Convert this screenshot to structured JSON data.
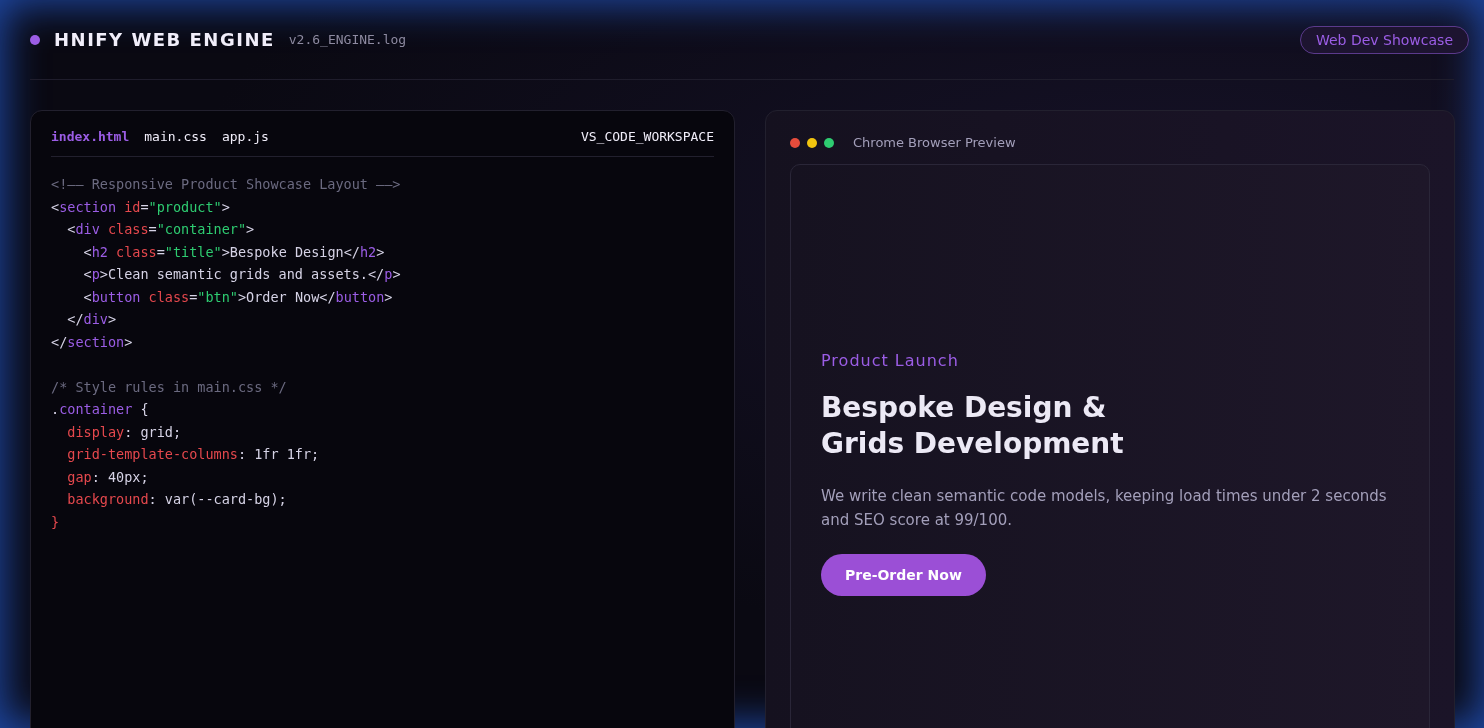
{
  "header": {
    "brand": "HNIFY WEB ENGINE",
    "version": "v2.6_ENGINE.log",
    "badge": "Web Dev Showcase"
  },
  "editor": {
    "tabs": [
      {
        "label": "index.html",
        "selected": true
      },
      {
        "label": "main.css",
        "selected": false
      },
      {
        "label": "app.js",
        "selected": false
      }
    ],
    "workspace": "VS_CODE_WORKSPACE",
    "lines": [
      {
        "kind": "code",
        "tokens": [
          {
            "kind": "comment",
            "text": "<!—— Responsive Product Showcase Layout ——>"
          }
        ]
      },
      {
        "kind": "code",
        "tokens": [
          {
            "kind": "punct",
            "text": "<"
          },
          {
            "kind": "tag",
            "text": "section"
          },
          {
            "kind": "attr",
            "text": " id"
          },
          {
            "kind": "punct",
            "text": "="
          },
          {
            "kind": "string",
            "text": "\"product\""
          },
          {
            "kind": "punct",
            "text": ">"
          }
        ]
      },
      {
        "kind": "code",
        "tokens": [
          {
            "kind": "punct",
            "text": "  <"
          },
          {
            "kind": "tag",
            "text": "div"
          },
          {
            "kind": "attr",
            "text": " class"
          },
          {
            "kind": "punct",
            "text": "="
          },
          {
            "kind": "string",
            "text": "\"container\""
          },
          {
            "kind": "punct",
            "text": ">"
          }
        ]
      },
      {
        "kind": "code",
        "tokens": [
          {
            "kind": "punct",
            "text": "    <"
          },
          {
            "kind": "tag",
            "text": "h2"
          },
          {
            "kind": "attr",
            "text": " class"
          },
          {
            "kind": "punct",
            "text": "="
          },
          {
            "kind": "string",
            "text": "\"title\""
          },
          {
            "kind": "punct",
            "text": ">Bespoke Design</"
          },
          {
            "kind": "tag",
            "text": "h2"
          },
          {
            "kind": "punct",
            "text": ">"
          }
        ]
      },
      {
        "kind": "code",
        "tokens": [
          {
            "kind": "punct",
            "text": "    <"
          },
          {
            "kind": "tag",
            "text": "p"
          },
          {
            "kind": "punct",
            "text": ">Clean semantic grids and assets.</"
          },
          {
            "kind": "tag",
            "text": "p"
          },
          {
            "kind": "punct",
            "text": ">"
          }
        ]
      },
      {
        "kind": "code",
        "tokens": [
          {
            "kind": "punct",
            "text": "    <"
          },
          {
            "kind": "tag",
            "text": "button"
          },
          {
            "kind": "attr",
            "text": " class"
          },
          {
            "kind": "punct",
            "text": "="
          },
          {
            "kind": "string",
            "text": "\"btn\""
          },
          {
            "kind": "punct",
            "text": ">Order Now</"
          },
          {
            "kind": "tag",
            "text": "button"
          },
          {
            "kind": "punct",
            "text": ">"
          }
        ]
      },
      {
        "kind": "code",
        "tokens": [
          {
            "kind": "punct",
            "text": "  </"
          },
          {
            "kind": "tag",
            "text": "div"
          },
          {
            "kind": "punct",
            "text": ">"
          }
        ]
      },
      {
        "kind": "code",
        "tokens": [
          {
            "kind": "punct",
            "text": "</"
          },
          {
            "kind": "tag",
            "text": "section"
          },
          {
            "kind": "punct",
            "text": ">"
          }
        ]
      },
      {
        "kind": "blank"
      },
      {
        "kind": "code",
        "tokens": [
          {
            "kind": "comment",
            "text": "/* Style rules in main.css */"
          }
        ]
      },
      {
        "kind": "code",
        "tokens": [
          {
            "kind": "punct",
            "text": "."
          },
          {
            "kind": "tag",
            "text": "container"
          },
          {
            "kind": "punct",
            "text": " {"
          }
        ]
      },
      {
        "kind": "code",
        "tokens": [
          {
            "kind": "attr",
            "text": "  display"
          },
          {
            "kind": "punct",
            "text": ": grid;"
          }
        ]
      },
      {
        "kind": "code",
        "tokens": [
          {
            "kind": "attr",
            "text": "  grid-template-columns"
          },
          {
            "kind": "punct",
            "text": ": 1fr 1fr;"
          }
        ]
      },
      {
        "kind": "code",
        "tokens": [
          {
            "kind": "attr",
            "text": "  gap"
          },
          {
            "kind": "punct",
            "text": ": 40px;"
          }
        ]
      },
      {
        "kind": "code",
        "tokens": [
          {
            "kind": "attr",
            "text": "  background"
          },
          {
            "kind": "punct",
            "text": ": var(--card-bg);"
          }
        ]
      },
      {
        "kind": "code",
        "tokens": [
          {
            "kind": "brace",
            "text": "}"
          }
        ]
      }
    ]
  },
  "preview": {
    "dots": [
      {
        "color": "#e74c3c"
      },
      {
        "color": "#f1c40f"
      },
      {
        "color": "#2ecc71"
      }
    ],
    "title": "Chrome Browser Preview",
    "eyebrow": "Product Launch",
    "heading_lines": [
      "Bespoke Design &",
      "Grids Development"
    ],
    "description": "We write clean semantic code models, keeping load times under 2 seconds and SEO score at 99/100.",
    "button": "Pre-Order Now"
  }
}
